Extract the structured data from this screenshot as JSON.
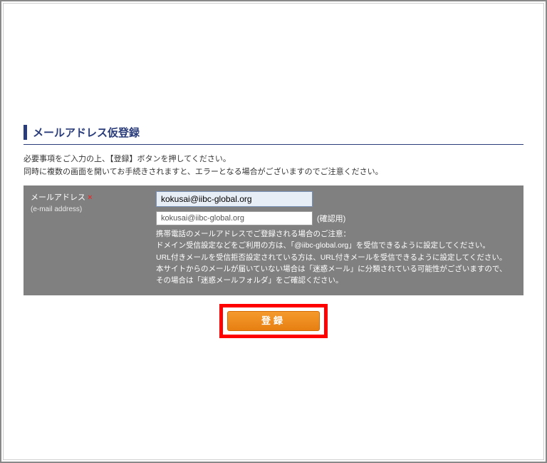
{
  "section": {
    "title": "メールアドレス仮登録",
    "intro_line1": "必要事項をご入力の上、【登録】ボタンを押してください。",
    "intro_line2": "同時に複数の画面を開いてお手続きされますと、エラーとなる場合がございますのでご注意ください。"
  },
  "form": {
    "label": "メールアドレス",
    "required_mark": "×",
    "label_sub": "(e-mail address)",
    "email_value": "kokusai@iibc-global.org",
    "confirm_value": "kokusai@iibc-global.org",
    "confirm_label": "(確認用)",
    "note_line1": "携帯電話のメールアドレスでご登録される場合のご注意：",
    "note_line2": "ドメイン受信設定などをご利用の方は、「@iibc-global.org」を受信できるように設定してください。",
    "note_line3": "URL付きメールを受信拒否設定されている方は、URL付きメールを受信できるように設定してください。",
    "note_line4": "本サイトからのメールが届いていない場合は「迷惑メール」に分類されている可能性がございますので、",
    "note_line5": "その場合は「迷惑メールフォルダ」をご確認ください。"
  },
  "submit": {
    "label": "登録"
  }
}
